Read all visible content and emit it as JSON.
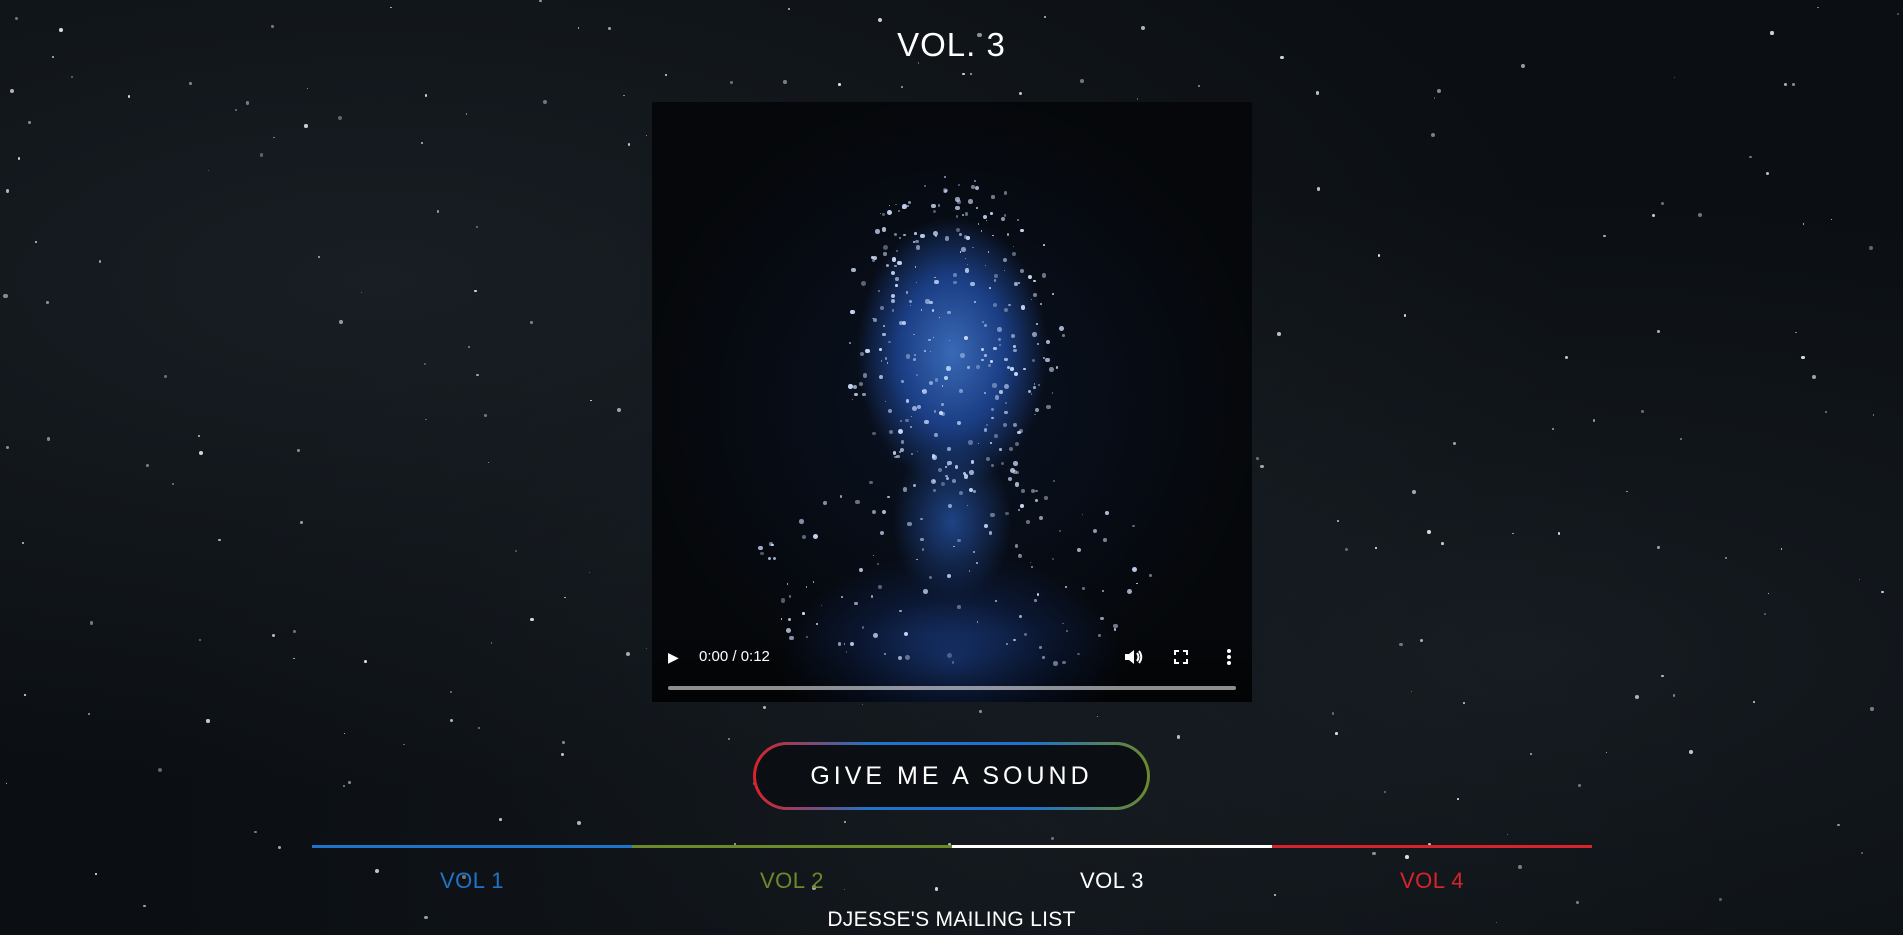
{
  "page": {
    "title": "VOL. 3"
  },
  "video": {
    "time": "0:00 / 0:12",
    "progress": 0,
    "icons": {
      "play": "play-icon",
      "volume": "volume-icon",
      "fullscreen": "fullscreen-icon",
      "more": "more-options-icon"
    }
  },
  "cta": {
    "label": "GIVE ME A SOUND"
  },
  "tabs": [
    {
      "label": "VOL 1",
      "color": "#1f74c9",
      "active": false
    },
    {
      "label": "VOL 2",
      "color": "#6b8a2a",
      "active": false
    },
    {
      "label": "VOL 3",
      "color": "#ffffff",
      "active": true
    },
    {
      "label": "VOL 4",
      "color": "#d8232a",
      "active": false
    }
  ],
  "footer": {
    "mailing_list": "DJESSE'S MAILING LIST"
  }
}
